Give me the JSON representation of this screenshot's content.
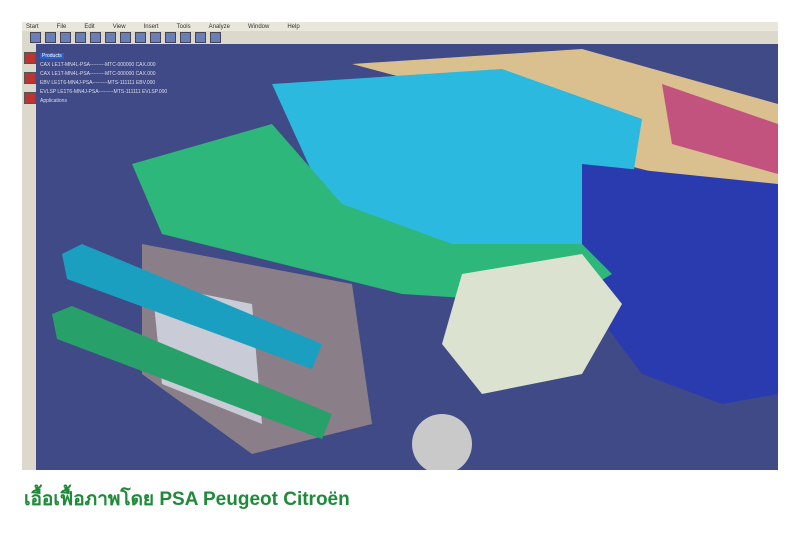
{
  "menu": [
    "Start",
    "File",
    "Edit",
    "View",
    "Insert",
    "Tools",
    "Analyze",
    "Window",
    "Help"
  ],
  "tree": {
    "root": "Products",
    "items": [
      "CAX LE1T-MN4L-PSA---------MTC-000000 CAX.000",
      "CAX LE1T-MN4L-PSA---------MTC-000000 CAX.000",
      "EBV LE1T6-MN4J-PSA---------MTS-111111 EBV.000",
      "EVLSP LE1T6-MN4J-PSA---------MTS-111111 EVLSP.000"
    ],
    "footer": "Applications"
  },
  "caption": "เอื้อเฟื้อภาพโดย PSA Peugeot Citroën"
}
